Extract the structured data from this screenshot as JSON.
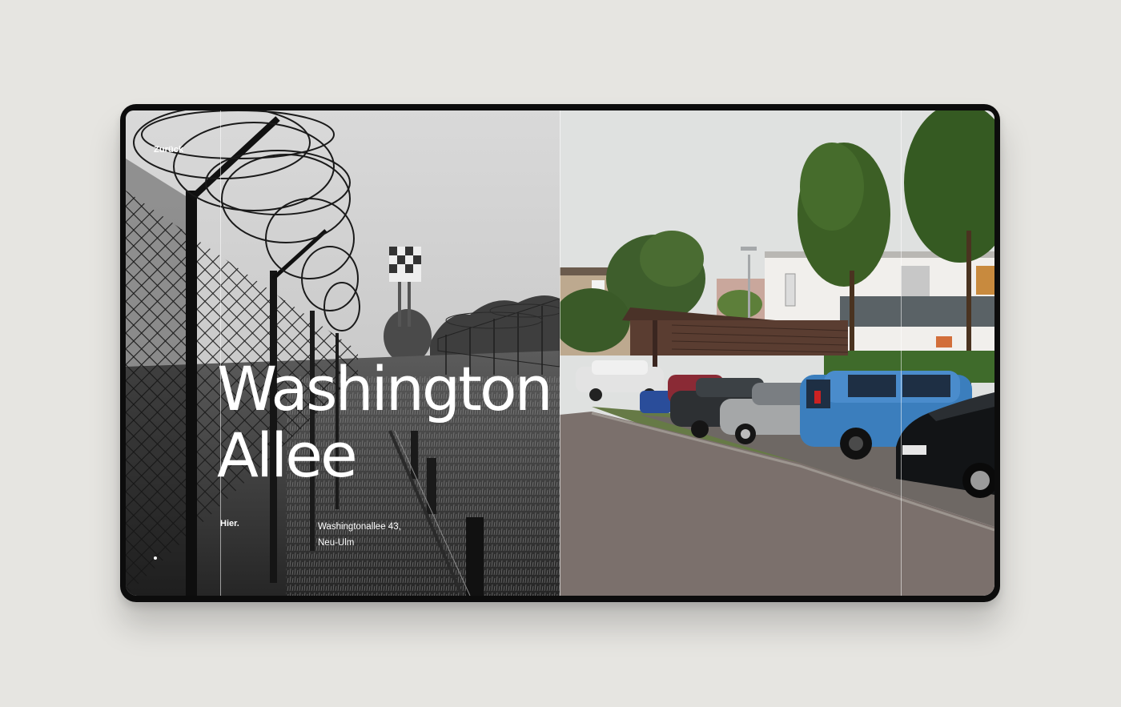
{
  "nav": {
    "back_label": "Zurück"
  },
  "hero": {
    "title_line1": "Washington",
    "title_line2": "Allee"
  },
  "location": {
    "label": "Hier.",
    "address_line1": "Washingtonallee 43,",
    "address_line2": "Neu-Ulm"
  },
  "images": {
    "left": "black-and-white-barbed-wire-fence-photo",
    "right": "color-parking-lot-street-photo"
  },
  "colors": {
    "page_background": "#e6e5e1",
    "device_frame": "#0c0c0c",
    "text": "#ffffff"
  }
}
